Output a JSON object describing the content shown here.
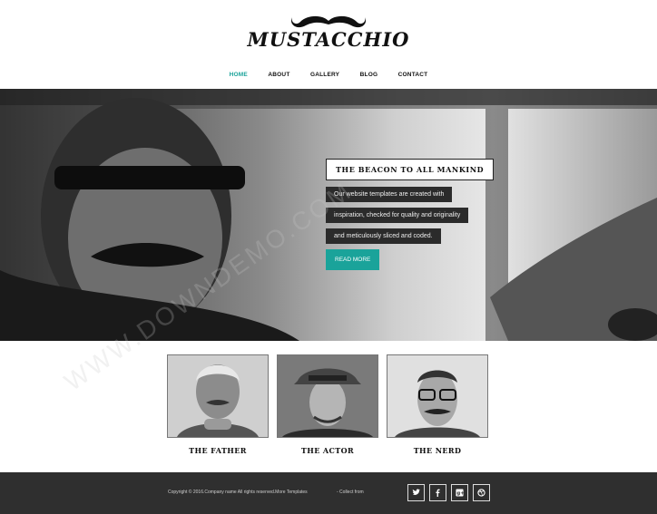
{
  "header": {
    "logo_text": "MUSTACCHIO",
    "nav": [
      "HOME",
      "ABOUT",
      "GALLERY",
      "BLOG",
      "CONTACT"
    ]
  },
  "hero": {
    "title": "THE BEACON TO ALL MANKIND",
    "lines": [
      "Our website templates are created with",
      "inspiration, checked for quality and originality",
      "and meticulously sliced and coded."
    ],
    "button_label": "READ MORE"
  },
  "portraits": [
    "THE FATHER",
    "THE ACTOR",
    "THE NERD"
  ],
  "footer": {
    "copyright": "Copyright © 2016.Company name All rights reserved.More Templates",
    "collect": "- Collect from",
    "social_icons": [
      "twitter-icon",
      "facebook-icon",
      "google-plus-icon",
      "dribbble-icon"
    ]
  },
  "watermark": "WWW.DOWNDEMO.COM",
  "colors": {
    "accent": "#1aa39a",
    "footer_bg": "#2f2f2f",
    "hero_text_bg": "#2b2b2b"
  }
}
